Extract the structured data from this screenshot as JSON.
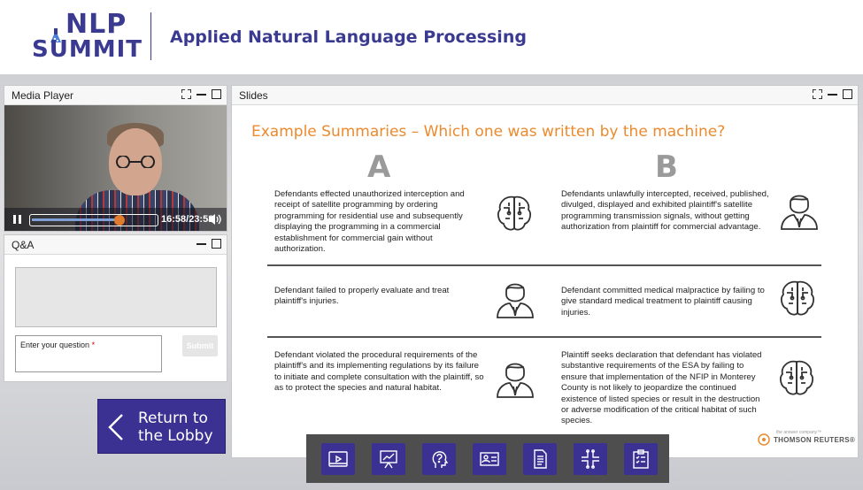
{
  "header": {
    "logo_line1": "NLP",
    "logo_line2": "SUMMIT",
    "title": "Applied Natural Language Processing"
  },
  "media_player": {
    "title": "Media Player",
    "time": "16:58/23:58",
    "progress": 0.71
  },
  "qa": {
    "title": "Q&A",
    "input_placeholder": "Enter your question",
    "required_mark": "*",
    "submit_label": "Submit"
  },
  "lobby": {
    "line1": "Return to",
    "line2": "the Lobby"
  },
  "slides": {
    "title": "Slides",
    "heading": "Example Summaries – Which one was written by the machine?",
    "col_a": "A",
    "col_b": "B",
    "rows": [
      {
        "a_text": "Defendants effected unauthorized interception and receipt of satellite programming by ordering programming for residential use and subsequently displaying the programming in a commercial establishment for commercial gain without authorization.",
        "a_icon": "brain-icon",
        "b_text": "Defendants unlawfully intercepted, received, published, divulged, displayed and exhibited plaintiff's satellite programming transmission signals, without getting authorization from plaintiff for commercial advantage.",
        "b_icon": "person-icon"
      },
      {
        "a_text": "Defendant failed to properly evaluate and treat plaintiff's injuries.",
        "a_icon": "person-icon",
        "b_text": "Defendant committed medical malpractice by failing to give standard medical treatment to plaintiff causing injuries.",
        "b_icon": "brain-icon"
      },
      {
        "a_text": "Defendant violated the procedural requirements of the plaintiff's and its implementing regulations by its failure to initiate and complete consultation with the plaintiff, so as to protect the species and natural habitat.",
        "a_icon": "person-icon",
        "b_text": "Plaintiff seeks declaration that defendant has violated substantive requirements of the ESA by failing to ensure that implementation of the NFIP in Monterey County is not likely to jeopardize the continued existence of listed species or result in the destruction or adverse modification of the critical habitat of such species.",
        "b_icon": "brain-icon"
      }
    ],
    "brand_small": "the answer company™",
    "brand": "THOMSON REUTERS®"
  },
  "toolbar": {
    "items": [
      "media-player-tool",
      "slides-tool",
      "qa-tool",
      "speaker-bio-tool",
      "document-tool",
      "network-tool",
      "survey-tool"
    ]
  },
  "colors": {
    "brand_purple": "#3b3193",
    "accent_orange": "#ec8a2e"
  }
}
